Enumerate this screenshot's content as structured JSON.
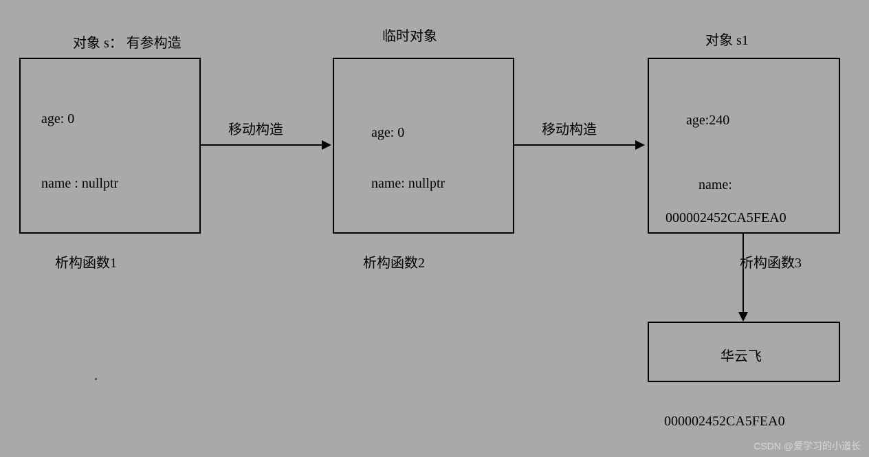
{
  "box1": {
    "title": "对象 s： 有参构造",
    "age": "age: 0",
    "name": "name : nullptr",
    "footer": "析构函数1"
  },
  "arrow1": {
    "label": "移动构造"
  },
  "box2": {
    "title": "临时对象",
    "age": "age: 0",
    "name": "name: nullptr",
    "footer": "析构函数2"
  },
  "arrow2": {
    "label": "移动构造"
  },
  "box3": {
    "title": "对象 s1",
    "age": "age:240",
    "name": "name:",
    "addr": "000002452CA5FEA0",
    "footer": "析构函数3"
  },
  "box4": {
    "content": "华云飞",
    "addr": "000002452CA5FEA0"
  },
  "watermark": "CSDN @爱学习的小道长"
}
